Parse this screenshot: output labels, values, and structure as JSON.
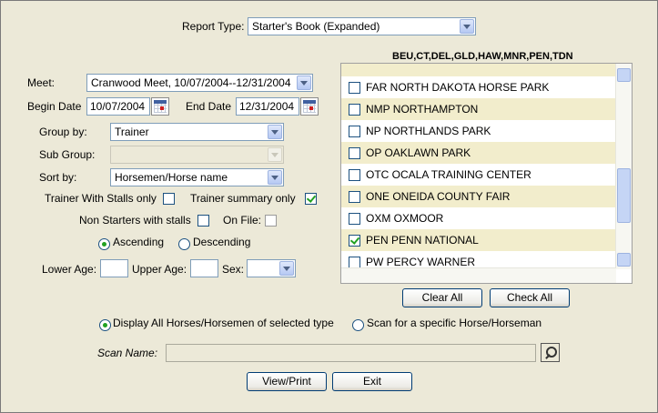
{
  "report_type": {
    "label": "Report Type:",
    "value": "Starter's Book (Expanded)"
  },
  "selected_codes": "BEU,CT,DEL,GLD,HAW,MNR,PEN,TDN",
  "meet": {
    "label": "Meet:",
    "value": "Cranwood Meet, 10/07/2004--12/31/2004"
  },
  "begin_date": {
    "label": "Begin Date",
    "value": "10/07/2004"
  },
  "end_date": {
    "label": "End Date",
    "value": "12/31/2004"
  },
  "group_by": {
    "label": "Group by:",
    "value": "Trainer"
  },
  "sub_group": {
    "label": "Sub Group:",
    "value": ""
  },
  "sort_by": {
    "label": "Sort by:",
    "value": "Horsemen/Horse name"
  },
  "options": {
    "trainer_with_stalls_only": "Trainer With Stalls only",
    "trainer_summary_only": "Trainer summary only",
    "non_starters_with_stalls": "Non Starters with stalls",
    "on_file": "On File:"
  },
  "order": {
    "ascending": "Ascending",
    "descending": "Descending"
  },
  "age": {
    "lower_label": "Lower Age:",
    "upper_label": "Upper Age:",
    "sex_label": "Sex:"
  },
  "tracks": [
    {
      "label": "FAR NORTH DAKOTA HORSE PARK",
      "checked": false
    },
    {
      "label": "NMP NORTHAMPTON",
      "checked": false
    },
    {
      "label": "NP NORTHLANDS PARK",
      "checked": false
    },
    {
      "label": "OP OAKLAWN PARK",
      "checked": false
    },
    {
      "label": "OTC OCALA TRAINING CENTER",
      "checked": false
    },
    {
      "label": "ONE ONEIDA COUNTY FAIR",
      "checked": false
    },
    {
      "label": "OXM OXMOOR",
      "checked": false
    },
    {
      "label": "PEN PENN NATIONAL",
      "checked": true
    },
    {
      "label": "PW PERCY WARNER",
      "checked": false
    }
  ],
  "buttons": {
    "clear_all": "Clear All",
    "check_all": "Check All",
    "view_print": "View/Print",
    "exit": "Exit"
  },
  "scan": {
    "display_all": "Display All Horses/Horsemen of selected type",
    "scan_specific": "Scan for a specific Horse/Horseman",
    "name_label": "Scan Name:"
  },
  "colors": {
    "row_alt": "#f2edcc",
    "check_green": "#21a121",
    "window_bg": "#ece9d8"
  }
}
